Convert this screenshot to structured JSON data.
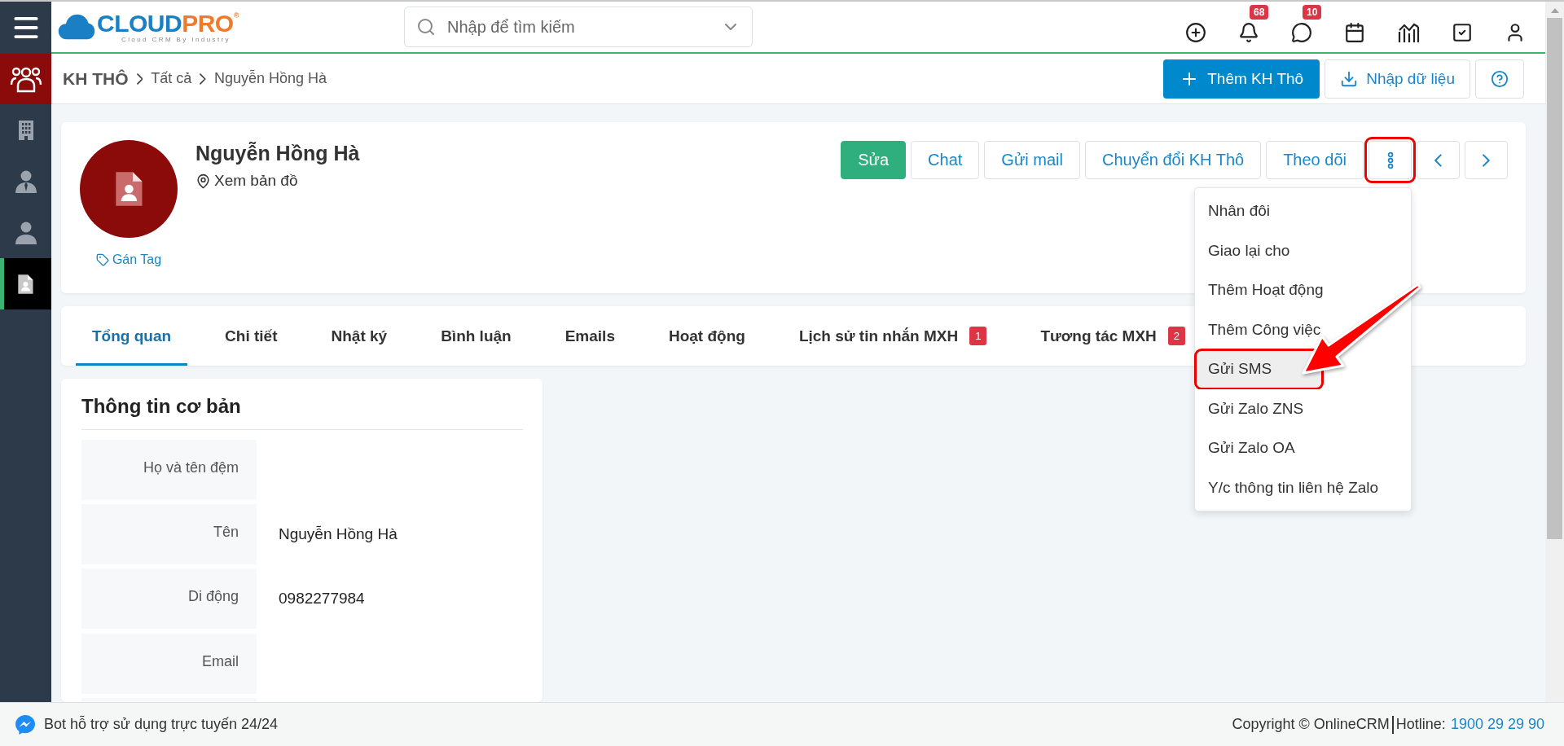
{
  "logo": {
    "brand_part1": "CLOUD",
    "brand_part2": "PRO",
    "registered": "®",
    "tagline": "Cloud CRM By Industry"
  },
  "search": {
    "placeholder": "Nhập để tìm kiếm"
  },
  "header_icons": [
    {
      "kind": "add"
    },
    {
      "kind": "bell",
      "badge": "68"
    },
    {
      "kind": "chat",
      "badge": "10"
    },
    {
      "kind": "calendar"
    },
    {
      "kind": "report"
    },
    {
      "kind": "task"
    },
    {
      "kind": "user"
    }
  ],
  "sidebar": {
    "items": [
      {
        "kind": "company",
        "selected": false
      },
      {
        "kind": "contact",
        "selected": false
      },
      {
        "kind": "person",
        "selected": false
      },
      {
        "kind": "lead",
        "selected": true
      }
    ]
  },
  "breadcrumb": [
    "KH THÔ",
    "Tất cả",
    "Nguyễn Hồng Hà"
  ],
  "page_actions": {
    "add_button": "Thêm KH Thô",
    "import_button": "Nhập dữ liệu"
  },
  "profile": {
    "name": "Nguyễn Hồng Hà",
    "map_link": "Xem bản đồ",
    "tag_link": "Gán Tag"
  },
  "record_actions": [
    {
      "kind": "primary",
      "label": "Sửa",
      "circled": false
    },
    {
      "kind": "outline",
      "label": "Chat",
      "circled": false
    },
    {
      "kind": "outline",
      "label": "Gửi mail",
      "circled": false
    },
    {
      "kind": "outline",
      "label": "Chuyển đổi KH Thô",
      "circled": false
    },
    {
      "kind": "outline",
      "label": "Theo dõi",
      "circled": false
    },
    {
      "kind": "more",
      "circled": true
    },
    {
      "kind": "prev",
      "circled": false
    },
    {
      "kind": "next",
      "circled": false
    }
  ],
  "more_menu": [
    {
      "label": "Nhân đôi",
      "highlighted": false,
      "circled": false
    },
    {
      "label": "Giao lại cho",
      "highlighted": false,
      "circled": false
    },
    {
      "label": "Thêm Hoạt động",
      "highlighted": false,
      "circled": false
    },
    {
      "label": "Thêm Công việc",
      "highlighted": false,
      "circled": false
    },
    {
      "label": "Gửi SMS",
      "highlighted": true,
      "circled": true
    },
    {
      "label": "Gửi Zalo ZNS",
      "highlighted": false,
      "circled": false
    },
    {
      "label": "Gửi Zalo OA",
      "highlighted": false,
      "circled": false
    },
    {
      "label": "Y/c thông tin liên hệ Zalo",
      "highlighted": false,
      "circled": false
    }
  ],
  "tabs": [
    {
      "label": "Tổng quan",
      "selected": true
    },
    {
      "label": "Chi tiết",
      "selected": false
    },
    {
      "label": "Nhật ký",
      "selected": false
    },
    {
      "label": "Bình luận",
      "selected": false
    },
    {
      "label": "Emails",
      "selected": false
    },
    {
      "label": "Hoạt động",
      "selected": false
    },
    {
      "label": "Lịch sử tin nhắn MXH",
      "selected": false,
      "badge": "1"
    },
    {
      "label": "Tương tác MXH",
      "selected": false,
      "badge": "2"
    }
  ],
  "basic_info": {
    "title": "Thông tin cơ bản",
    "fields": [
      {
        "label": "Họ và tên đệm"
      },
      {
        "label": "Tên",
        "value": "Nguyễn Hồng Hà"
      },
      {
        "label": "Di động",
        "value": "0982277984"
      },
      {
        "label": "Email"
      }
    ]
  },
  "footer": {
    "bot_text": "Bot hỗ trợ sử dụng trực tuyến 24/24",
    "copyright": "Copyright © OnlineCRM",
    "hotline_label": "Hotline:",
    "hotline": "1900 29 29 90"
  }
}
